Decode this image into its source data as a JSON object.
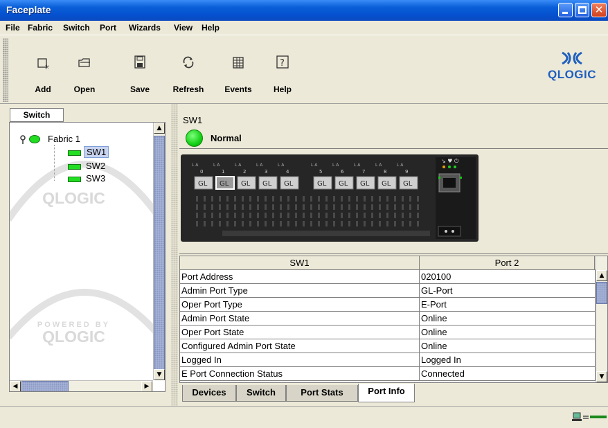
{
  "window": {
    "title": "Faceplate"
  },
  "menubar": {
    "items": [
      "File",
      "Fabric",
      "Switch",
      "Port",
      "Wizards",
      "View",
      "Help"
    ]
  },
  "toolbar": {
    "items": [
      {
        "label": "Add",
        "icon": "add-icon"
      },
      {
        "label": "Open",
        "icon": "open-folder-icon"
      },
      {
        "label": "Save",
        "icon": "save-icon"
      },
      {
        "label": "Refresh",
        "icon": "refresh-icon"
      },
      {
        "label": "Events",
        "icon": "events-icon"
      },
      {
        "label": "Help",
        "icon": "help-icon"
      }
    ],
    "logo_text": "QLOGIC"
  },
  "tree": {
    "tab_label": "Switch",
    "fabric": "Fabric 1",
    "switches": [
      "SW1",
      "SW2",
      "SW3"
    ],
    "selected": "SW1",
    "watermark_top": "QLOGIC",
    "watermark_powered": "POWERED BY",
    "watermark_bottom": "QLOGIC"
  },
  "switch_panel": {
    "name": "SW1",
    "status": "Normal",
    "status_color": "#22dd22"
  },
  "faceplate": {
    "port_numbers": [
      "0",
      "1",
      "2",
      "3",
      "4",
      "5",
      "6",
      "7",
      "8",
      "9"
    ],
    "port_labels": [
      "GL",
      "GL",
      "GL",
      "GL",
      "GL",
      "GL",
      "GL",
      "GL",
      "GL",
      "GL"
    ],
    "selected_port": 1,
    "led_label": "L A"
  },
  "table": {
    "columns": [
      "SW1",
      "Port 2"
    ],
    "rows": [
      [
        "Port Address",
        "020100"
      ],
      [
        "Admin Port Type",
        "GL-Port"
      ],
      [
        "Oper Port Type",
        "E-Port"
      ],
      [
        "Admin Port State",
        "Online"
      ],
      [
        "Oper Port State",
        "Online"
      ],
      [
        "Configured Admin Port State",
        "Online"
      ],
      [
        "Logged In",
        "Logged In"
      ],
      [
        "E Port Connection Status",
        "Connected"
      ]
    ]
  },
  "bottom_tabs": {
    "items": [
      "Devices",
      "Switch",
      "Port Stats",
      "Port Info"
    ],
    "active": "Port Info"
  },
  "colors": {
    "titlebar": "#0a5fd8",
    "accent": "#1f5fbf",
    "status_ok": "#22dd22"
  }
}
